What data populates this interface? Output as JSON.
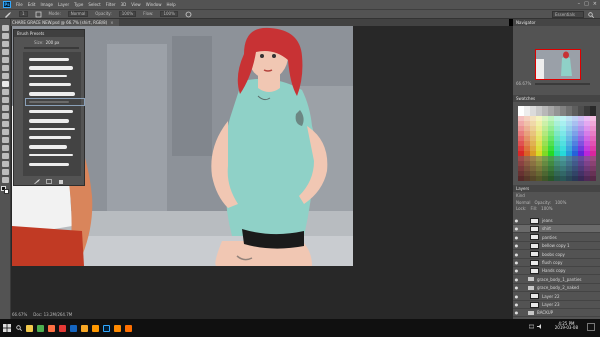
{
  "app": {
    "logo": "Ps",
    "menu": [
      "File",
      "Edit",
      "Image",
      "Layer",
      "Type",
      "Select",
      "Filter",
      "3D",
      "View",
      "Window",
      "Help"
    ],
    "window_controls": [
      "–",
      "□",
      "×"
    ]
  },
  "options": {
    "brush_size": "1",
    "mode_label": "Mode:",
    "mode_value": "Normal",
    "opacity_label": "Opacity:",
    "opacity_value": "100%",
    "flow_label": "Flow:",
    "flow_value": "100%",
    "workspace": "Essentials"
  },
  "document": {
    "tab_title": "CHARE GRACE NEW.psd @ 66.7% (shirt, RGB/8)",
    "status_zoom": "66.67%",
    "status_doc": "Doc: 13.2M/264.7M"
  },
  "brush_presets": {
    "title": "Brush Presets",
    "size_label": "Size:",
    "size_value": "200 px",
    "footer_icons": [
      "brush-panel-icon",
      "new-preset-icon",
      "delete-icon"
    ]
  },
  "panels": {
    "navigator_title": "Navigator",
    "navigator_zoom": "66.67%",
    "swatches_title": "Swatches",
    "layers_title": "Layers",
    "layers_kind": "Kind",
    "blend_mode": "Normal",
    "opacity_label": "Opacity:",
    "opacity_value": "100%",
    "lock_label": "Lock:",
    "fill_label": "Fill:",
    "fill_value": "100%"
  },
  "layers": [
    {
      "name": "jeans",
      "kind": "layer",
      "visible": true,
      "selected": false
    },
    {
      "name": "shirt",
      "kind": "layer",
      "visible": true,
      "selected": true
    },
    {
      "name": "panties",
      "kind": "layer",
      "visible": true,
      "selected": false
    },
    {
      "name": "bellow copy 1",
      "kind": "layer",
      "visible": true,
      "selected": false
    },
    {
      "name": "boobs copy",
      "kind": "layer",
      "visible": true,
      "selected": false
    },
    {
      "name": "flush copy",
      "kind": "layer",
      "visible": true,
      "selected": false
    },
    {
      "name": "Hands copy",
      "kind": "layer",
      "visible": true,
      "selected": false
    },
    {
      "name": "grace_body_1_panties",
      "kind": "folder",
      "visible": true,
      "selected": false
    },
    {
      "name": "grace_body_2_naked",
      "kind": "folder",
      "visible": true,
      "selected": false
    },
    {
      "name": "Layer 22",
      "kind": "layer",
      "visible": true,
      "selected": false
    },
    {
      "name": "Layer 23",
      "kind": "layer",
      "visible": true,
      "selected": false
    },
    {
      "name": "BACKUP",
      "kind": "folder",
      "visible": true,
      "selected": false
    }
  ],
  "taskbar": {
    "time": "4:25 PM",
    "date": "2019-03-08",
    "icons": [
      "file-explorer-icon",
      "chrome-icon",
      "firefox-icon",
      "media-player-icon",
      "steam-icon",
      "folder-icon",
      "sublime-icon",
      "photoshop-icon",
      "illustrator-icon",
      "vlc-icon"
    ],
    "colors": {
      "accent": "#31a8ff"
    }
  }
}
